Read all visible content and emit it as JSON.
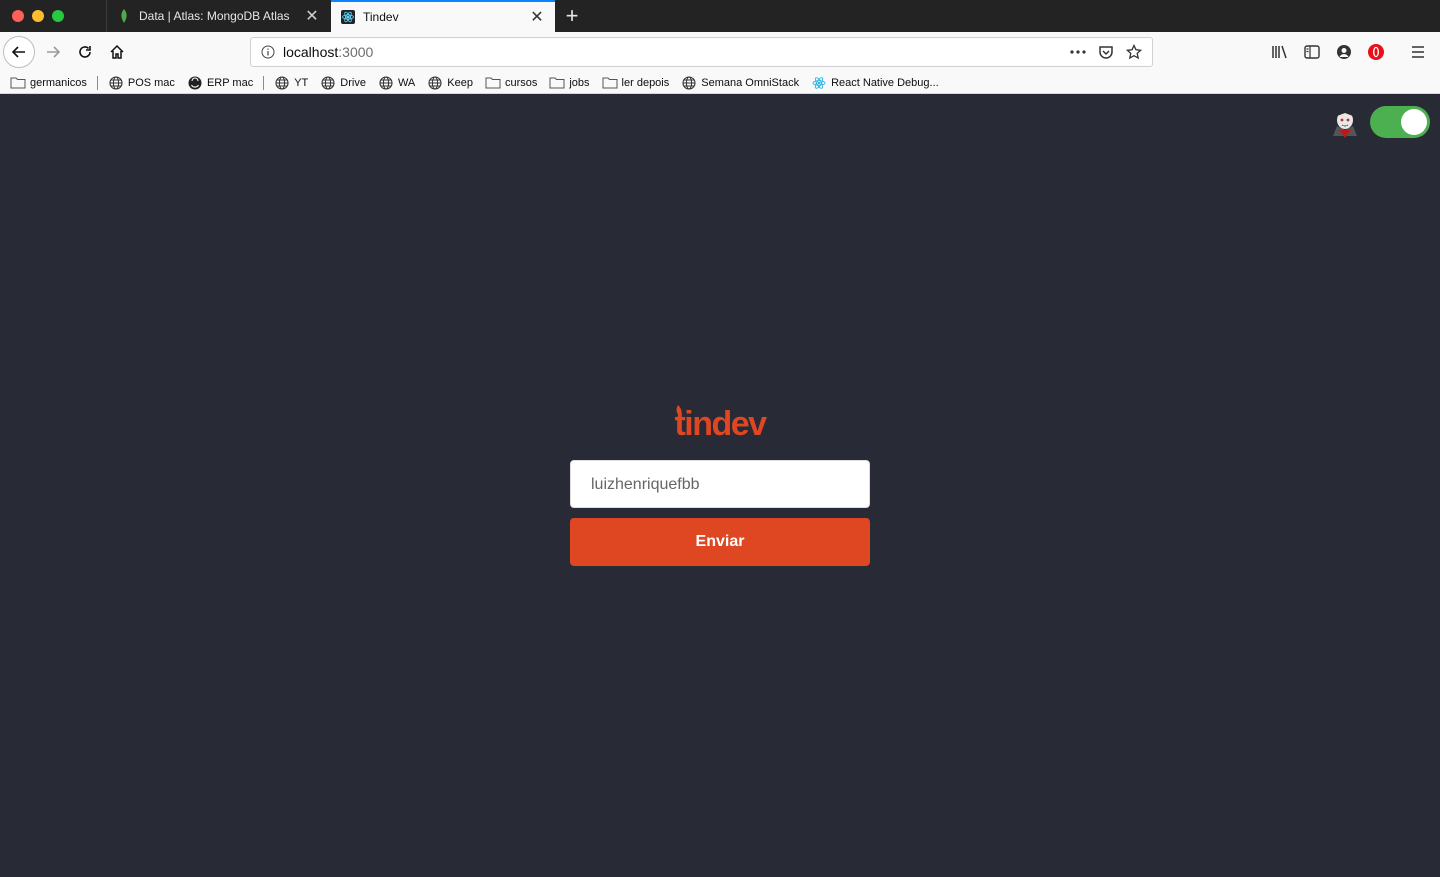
{
  "browser": {
    "tabs": [
      {
        "title": "Data | Atlas: MongoDB Atlas",
        "active": false,
        "favicon": "mongodb-leaf-icon"
      },
      {
        "title": "Tindev",
        "active": true,
        "favicon": "react-icon"
      }
    ],
    "url": {
      "host": "localhost",
      "port": ":3000"
    },
    "bookmarks": [
      {
        "label": "germanicos",
        "icon": "folder-icon"
      },
      {
        "label": "POS mac",
        "icon": "globe-icon"
      },
      {
        "label": "ERP mac",
        "icon": "dark-globe-icon"
      },
      {
        "label": "YT",
        "icon": "globe-icon"
      },
      {
        "label": "Drive",
        "icon": "globe-icon"
      },
      {
        "label": "WA",
        "icon": "globe-icon"
      },
      {
        "label": "Keep",
        "icon": "globe-icon"
      },
      {
        "label": "cursos",
        "icon": "folder-icon"
      },
      {
        "label": "jobs",
        "icon": "folder-icon"
      },
      {
        "label": "ler depois",
        "icon": "folder-icon"
      },
      {
        "label": "Semana OmniStack",
        "icon": "globe-icon"
      },
      {
        "label": "React Native Debug...",
        "icon": "react-icon"
      }
    ]
  },
  "app": {
    "logo_text": "tindev",
    "username_value": "luizhenriquefbb",
    "submit_label": "Enviar",
    "theme_toggle_on": true
  },
  "colors": {
    "background": "#282a36",
    "brand": "#df4723",
    "toggle_on": "#4caf50"
  }
}
